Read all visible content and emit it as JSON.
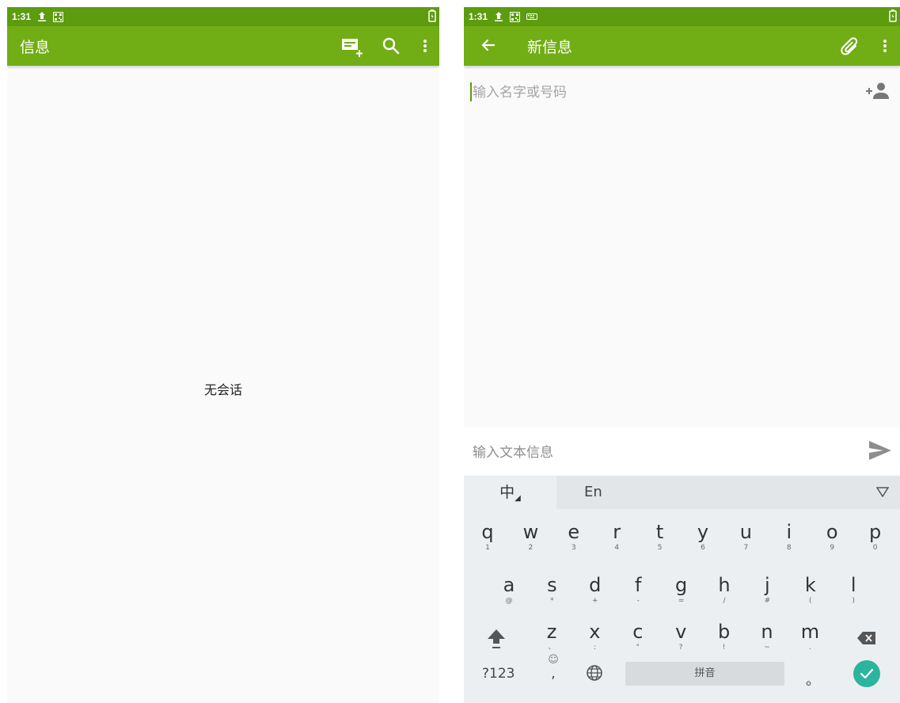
{
  "left_screen": {
    "status": {
      "time": "1:31"
    },
    "appbar": {
      "title": "信息"
    },
    "empty_message": "无会话"
  },
  "right_screen": {
    "status": {
      "time": "1:31"
    },
    "appbar": {
      "title": "新信息"
    },
    "recipient": {
      "placeholder": "输入名字或号码"
    },
    "compose": {
      "placeholder": "输入文本信息"
    },
    "keyboard": {
      "tab_zh": "中",
      "tab_en": "En",
      "row1": [
        {
          "k": "q",
          "s": "1"
        },
        {
          "k": "w",
          "s": "2"
        },
        {
          "k": "e",
          "s": "3"
        },
        {
          "k": "r",
          "s": "4"
        },
        {
          "k": "t",
          "s": "5"
        },
        {
          "k": "y",
          "s": "6"
        },
        {
          "k": "u",
          "s": "7"
        },
        {
          "k": "i",
          "s": "8"
        },
        {
          "k": "o",
          "s": "9"
        },
        {
          "k": "p",
          "s": "0"
        }
      ],
      "row2": [
        {
          "k": "a",
          "s": "@"
        },
        {
          "k": "s",
          "s": "*"
        },
        {
          "k": "d",
          "s": "+"
        },
        {
          "k": "f",
          "s": "-"
        },
        {
          "k": "g",
          "s": "="
        },
        {
          "k": "h",
          "s": "/"
        },
        {
          "k": "j",
          "s": "#"
        },
        {
          "k": "k",
          "s": "("
        },
        {
          "k": "l",
          "s": ")"
        }
      ],
      "row3": [
        {
          "k": "z",
          "s": "、"
        },
        {
          "k": "x",
          "s": ":"
        },
        {
          "k": "c",
          "s": "\""
        },
        {
          "k": "v",
          "s": "?"
        },
        {
          "k": "b",
          "s": "!"
        },
        {
          "k": "n",
          "s": "~"
        },
        {
          "k": "m",
          "s": "."
        }
      ],
      "mode_label": "?123",
      "comma": ",",
      "space_label": "拼音",
      "period": "。"
    }
  },
  "colors": {
    "statusbar": "#5c9c0e",
    "appbar": "#71ad15",
    "confirm": "#2cb49e"
  }
}
